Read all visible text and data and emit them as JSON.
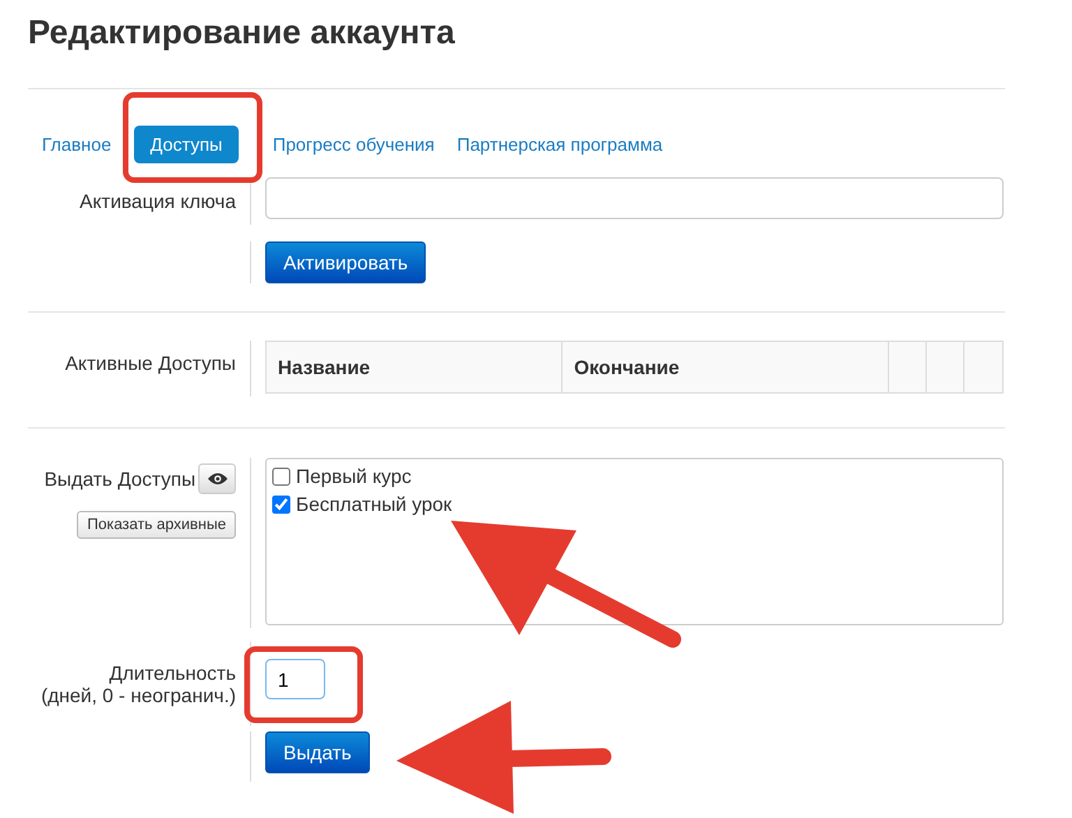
{
  "title": "Редактирование аккаунта",
  "tabs": [
    {
      "label": "Главное",
      "selected": false
    },
    {
      "label": "Доступы",
      "selected": true
    },
    {
      "label": "Прогресс обучения",
      "selected": false
    },
    {
      "label": "Партнерская программа",
      "selected": false
    }
  ],
  "key_activation": {
    "label": "Активация ключа",
    "button": "Активировать"
  },
  "active_access": {
    "label": "Активные Доступы",
    "columns": [
      "Название",
      "Окончание"
    ]
  },
  "grant": {
    "label": "Выдать Доступы",
    "archive_button": "Показать архивные",
    "courses": [
      {
        "label": "Первый курс",
        "checked": false
      },
      {
        "label": "Бесплатный урок",
        "checked": true
      }
    ],
    "duration_label": "Длительность",
    "duration_hint": "(дней, 0 - неогранич.)",
    "duration_value": "1",
    "button": "Выдать"
  }
}
